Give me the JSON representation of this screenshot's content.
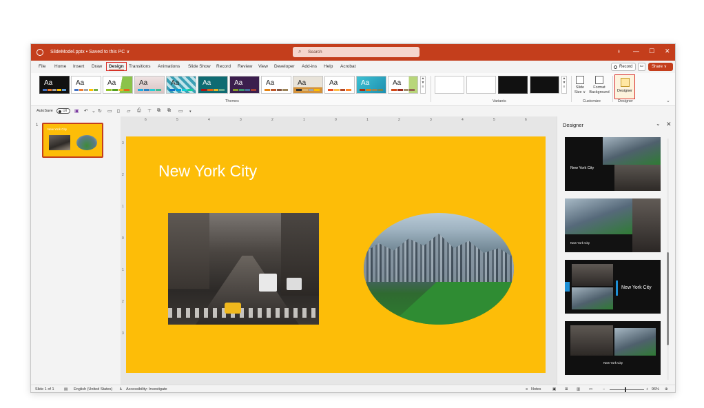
{
  "window": {
    "doc_title": "SlideModel.pptx • Saved to this PC ∨",
    "search_placeholder": "Search"
  },
  "tabs": [
    "File",
    "Home",
    "Insert",
    "Draw",
    "Design",
    "Transitions",
    "Animations",
    "Slide Show",
    "Record",
    "Review",
    "View",
    "Developer",
    "Add-ins",
    "Help",
    "Acrobat"
  ],
  "active_tab": "Design",
  "ribbon": {
    "record_label": "Record",
    "share_label": "Share ∨",
    "themes_label": "Themes",
    "theme_text": "Aa",
    "variants_label": "Variants",
    "customize_label": "Customize",
    "designer_group_label": "Designer",
    "slide_size_line1": "Slide",
    "slide_size_line2": "Size ∨",
    "format_bg_line1": "Format",
    "format_bg_line2": "Background",
    "designer_button": "Designer"
  },
  "qat": {
    "autosave_label": "AutoSave",
    "toggle_state": "Off"
  },
  "slides_pane": {
    "slide_number": "1",
    "thumb_title": "New York City"
  },
  "slide": {
    "title": "New York City"
  },
  "designer_pane": {
    "title": "Designer",
    "cards": [
      "New York City",
      "New York City",
      "New York City",
      "New York City"
    ]
  },
  "status": {
    "slide_count": "Slide 1 of 1",
    "language": "English (United States)",
    "accessibility": "Accessibility: Investigate",
    "notes": "Notes",
    "zoom": "96%"
  },
  "ruler_top": [
    "6",
    "5",
    "4",
    "3",
    "2",
    "1",
    "0",
    "1",
    "2",
    "3",
    "4",
    "5",
    "6"
  ],
  "ruler_left": [
    "3",
    "2",
    "1",
    "0",
    "1",
    "2",
    "3"
  ],
  "colors": {
    "accent": "#c43e1c",
    "slide_bg": "#fdbd08",
    "highlight": "#d9302b"
  }
}
